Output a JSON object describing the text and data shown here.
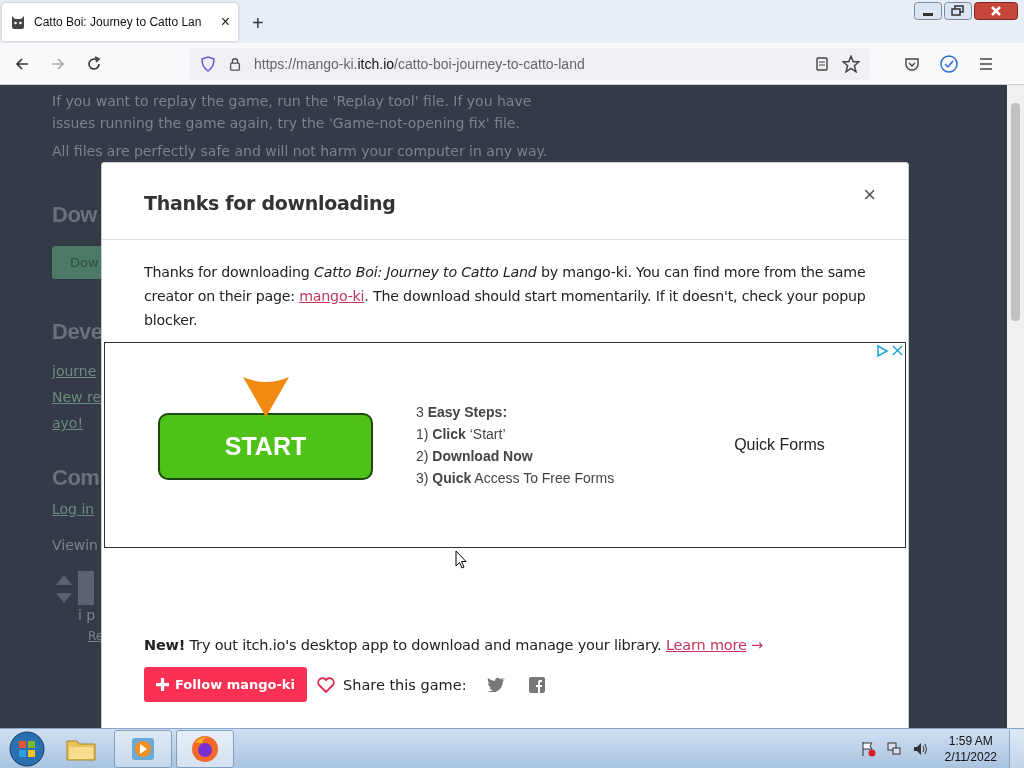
{
  "browser": {
    "tab": {
      "title": "Catto Boi: Journey to Catto Lan",
      "selected": true,
      "close": "×"
    },
    "new_tab": "+",
    "url_prefix": "https://mango-ki.",
    "url_domain": "itch.io",
    "url_path": "/catto-boi-journey-to-catto-land"
  },
  "background": {
    "paragraphs": [
      "If you want to replay the game, run the 'Replay tool' file. If you have issues running the game again, try the 'Game-not-opening fix' file.",
      "All files are perfectly safe and will not harm your computer in any way."
    ],
    "fragments": [
      {
        "kind": "heading",
        "text": "Dow"
      },
      {
        "kind": "button",
        "text": "Dow"
      },
      {
        "kind": "heading",
        "text": "Deve"
      },
      {
        "kind": "link",
        "text": "journe"
      },
      {
        "kind": "link",
        "text": "New re"
      },
      {
        "kind": "link",
        "text": "ayo!"
      },
      {
        "kind": "heading",
        "text": "Com"
      },
      {
        "kind": "link",
        "text": "Log in"
      },
      {
        "kind": "text",
        "text": "Viewin"
      },
      {
        "kind": "comment",
        "text": "i p"
      },
      {
        "kind": "small",
        "text": "Re"
      }
    ]
  },
  "modal": {
    "title": "Thanks for downloading",
    "close": "×",
    "message_before": "Thanks for downloading *Catto Boi: Journey to Catto Land* by mango-ki. You can find more from the same creator on their page: ",
    "message_link": "mango-ki",
    "message_after": ". The download should start momentarily. If it doesn't, check your popup blocker.",
    "ad": {
      "button": "START",
      "heading": "3 **Easy Steps:**",
      "steps": [
        "1) **Click** ‘Start’",
        "2) **Download Now**",
        "3) **Quick** Access To Free Forms"
      ],
      "side_text": "Quick Forms"
    },
    "promo": "**New!** Try out itch.io's desktop app to download and manage your library.",
    "promo_link": "Learn more",
    "promo_arrow": "→",
    "follow_button": "Follow mango-ki",
    "share_label": "Share this game:"
  },
  "taskbar": {
    "time": "1:59 AM",
    "date": "2/11/2022"
  }
}
